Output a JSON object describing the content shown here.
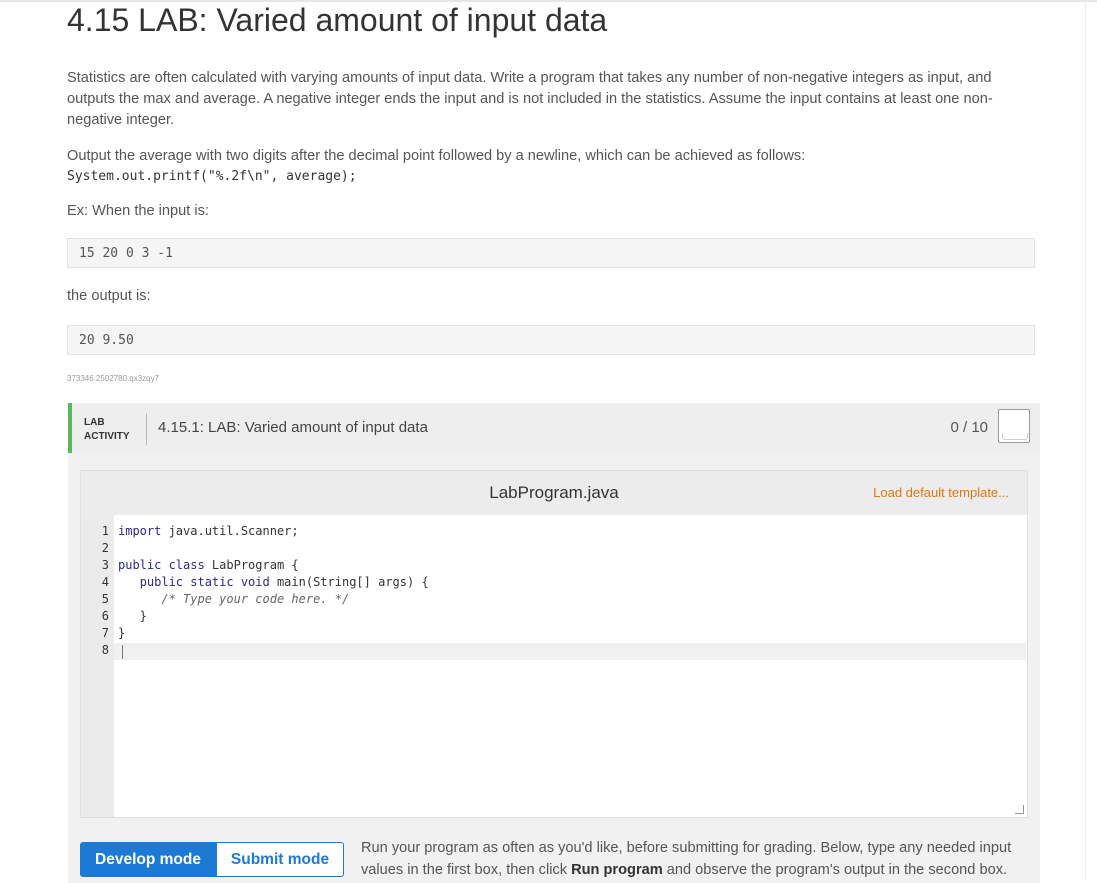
{
  "title": "4.15 LAB: Varied amount of input data",
  "intro": "Statistics are often calculated with varying amounts of input data. Write a program that takes any number of non-negative integers as input, and outputs the max and average. A negative integer ends the input and is not included in the statistics. Assume the input contains at least one non-negative integer.",
  "output_instruction": "Output the average with two digits after the decimal point followed by a newline, which can be achieved as follows:",
  "code_sample": "System.out.printf(\"%.2f\\n\", average);",
  "ex_input_label": "Ex: When the input is:",
  "ex_input": "15 20 0 3 -1",
  "ex_output_label": "the output is:",
  "ex_output": "20 9.50",
  "hash": "373346.2502780.qx3zqy7",
  "lab": {
    "tag_line1": "LAB",
    "tag_line2": "ACTIVITY",
    "title": "4.15.1: LAB: Varied amount of input data",
    "score": "0 / 10"
  },
  "editor": {
    "filename": "LabProgram.java",
    "load_template": "Load default template...",
    "line_numbers": [
      "1",
      "2",
      "3",
      "4",
      "5",
      "6",
      "7",
      "8"
    ]
  },
  "modes": {
    "develop": "Develop mode",
    "submit": "Submit mode"
  },
  "run_text": {
    "part1": "Run your program as often as you'd like, before submitting for grading. Below, type any needed input values in the first box, then click ",
    "bold": "Run program",
    "part2": " and observe the program's output in the second box."
  },
  "colors": {
    "accent_green": "#5cb85c",
    "mode_blue": "#1d7ad4",
    "link_orange": "#e8740c"
  }
}
